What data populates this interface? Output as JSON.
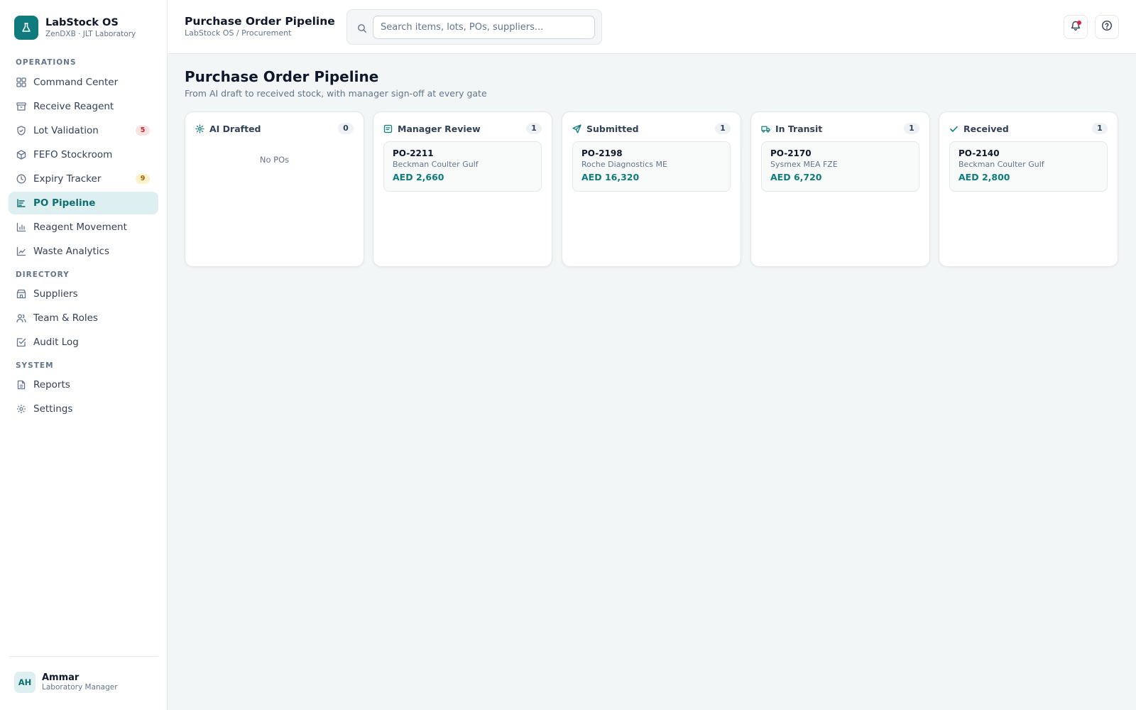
{
  "brand": {
    "title": "LabStock OS",
    "subtitle": "ZenDXB · JLT Laboratory",
    "accent": "#0f7b7c"
  },
  "sidebar": {
    "sections": [
      {
        "label": "OPERATIONS"
      },
      {
        "label": "DIRECTORY"
      },
      {
        "label": "SYSTEM"
      }
    ],
    "items": [
      {
        "label": "Command Center",
        "icon": "grid-icon"
      },
      {
        "label": "Receive Reagent",
        "icon": "archive-icon"
      },
      {
        "label": "Lot Validation",
        "icon": "shield-check-icon",
        "badge": "5"
      },
      {
        "label": "FEFO Stockroom",
        "icon": "box-icon"
      },
      {
        "label": "Expiry Tracker",
        "icon": "clock-icon",
        "badge": "9"
      },
      {
        "label": "PO Pipeline",
        "icon": "pipeline-icon",
        "active": true
      },
      {
        "label": "Reagent Movement",
        "icon": "bar-chart-icon"
      },
      {
        "label": "Waste Analytics",
        "icon": "line-chart-icon"
      },
      {
        "label": "Suppliers",
        "icon": "store-icon"
      },
      {
        "label": "Team & Roles",
        "icon": "users-icon"
      },
      {
        "label": "Audit Log",
        "icon": "check-square-icon"
      },
      {
        "label": "Reports",
        "icon": "file-icon"
      },
      {
        "label": "Settings",
        "icon": "gear-icon"
      }
    ]
  },
  "user": {
    "initials": "AH",
    "name": "Ammar",
    "role": "Laboratory Manager"
  },
  "header": {
    "title": "Purchase Order Pipeline",
    "breadcrumb": "LabStock OS / Procurement",
    "search_placeholder": "Search items, lots, POs, suppliers..."
  },
  "main": {
    "title": "Purchase Order Pipeline",
    "subtitle": "From AI draft to received stock, with manager sign-off at every gate"
  },
  "columns": [
    {
      "title": "AI Drafted",
      "icon": "sparkle-icon",
      "count": "0",
      "empty_text": "No POs",
      "po": null
    },
    {
      "title": "Manager Review",
      "icon": "review-icon",
      "count": "1",
      "po": {
        "id": "PO-2211",
        "supplier": "Beckman Coulter Gulf",
        "amount": "AED 2,660"
      }
    },
    {
      "title": "Submitted",
      "icon": "send-icon",
      "count": "1",
      "po": {
        "id": "PO-2198",
        "supplier": "Roche Diagnostics ME",
        "amount": "AED 16,320"
      }
    },
    {
      "title": "In Transit",
      "icon": "truck-icon",
      "count": "1",
      "po": {
        "id": "PO-2170",
        "supplier": "Sysmex MEA FZE",
        "amount": "AED 6,720"
      }
    },
    {
      "title": "Received",
      "icon": "check-icon",
      "count": "1",
      "po": {
        "id": "PO-2140",
        "supplier": "Beckman Coulter Gulf",
        "amount": "AED 2,800"
      }
    }
  ]
}
